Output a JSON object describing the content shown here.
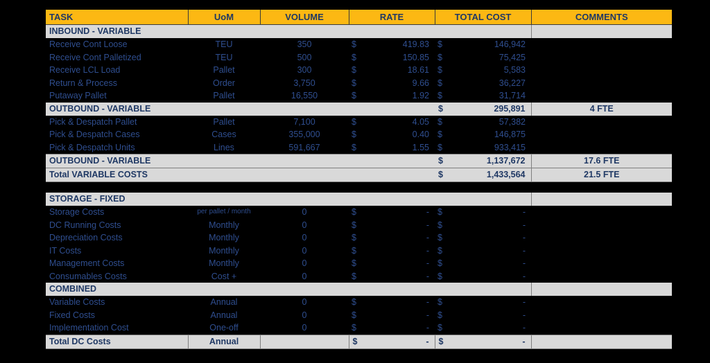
{
  "colors": {
    "header_bg": "#FCB813",
    "band_bg": "#D9D9D9",
    "text_navy": "#1F3864",
    "data_text": "#2F4E8F",
    "page_bg": "#000000"
  },
  "columns": [
    {
      "key": "task",
      "label": "TASK",
      "align": "left"
    },
    {
      "key": "uom",
      "label": "UoM",
      "align": "center"
    },
    {
      "key": "volume",
      "label": "VOLUME",
      "align": "center"
    },
    {
      "key": "rate",
      "label": "RATE",
      "align": "center"
    },
    {
      "key": "total_cost",
      "label": "TOTAL COST",
      "align": "center"
    },
    {
      "key": "comments",
      "label": "COMMENTS",
      "align": "center"
    }
  ],
  "sections": [
    {
      "band": {
        "label": "INBOUND - VARIABLE",
        "total_symbol": "",
        "total_value": "",
        "comments": ""
      },
      "rows": [
        {
          "task": "Receive Cont Loose",
          "uom": "TEU",
          "volume": "350",
          "rate_symbol": "$",
          "rate": "419.83",
          "tc_symbol": "$",
          "total_cost": "146,942",
          "comments": ""
        },
        {
          "task": "Receive Cont Palletized",
          "uom": "TEU",
          "volume": "500",
          "rate_symbol": "$",
          "rate": "150.85",
          "tc_symbol": "$",
          "total_cost": "75,425",
          "comments": ""
        },
        {
          "task": "Receive LCL Load",
          "uom": "Pallet",
          "volume": "300",
          "rate_symbol": "$",
          "rate": "18.61",
          "tc_symbol": "$",
          "total_cost": "5,583",
          "comments": ""
        },
        {
          "task": "Return & Process",
          "uom": "Order",
          "volume": "3,750",
          "rate_symbol": "$",
          "rate": "9.66",
          "tc_symbol": "$",
          "total_cost": "36,227",
          "comments": ""
        },
        {
          "task": "Putaway Pallet",
          "uom": "Pallet",
          "volume": "16,550",
          "rate_symbol": "$",
          "rate": "1.92",
          "tc_symbol": "$",
          "total_cost": "31,714",
          "comments": ""
        }
      ]
    },
    {
      "band": {
        "label": "OUTBOUND - VARIABLE",
        "total_symbol": "$",
        "total_value": "295,891",
        "comments": "4 FTE"
      },
      "rows": [
        {
          "task": "Pick & Despatch Pallet",
          "uom": "Pallet",
          "volume": "7,100",
          "rate_symbol": "$",
          "rate": "4.05",
          "tc_symbol": "$",
          "total_cost": "57,382",
          "comments": ""
        },
        {
          "task": "Pick & Despatch Cases",
          "uom": "Cases",
          "volume": "355,000",
          "rate_symbol": "$",
          "rate": "0.40",
          "tc_symbol": "$",
          "total_cost": "146,875",
          "comments": ""
        },
        {
          "task": "Pick & Despatch Units",
          "uom": "Lines",
          "volume": "591,667",
          "rate_symbol": "$",
          "rate": "1.55",
          "tc_symbol": "$",
          "total_cost": "933,415",
          "comments": ""
        }
      ]
    }
  ],
  "summary_bands": [
    {
      "label": "OUTBOUND - VARIABLE",
      "total_symbol": "$",
      "total_value": "1,137,672",
      "comments": "17.6 FTE"
    },
    {
      "label": "Total VARIABLE COSTS",
      "total_symbol": "$",
      "total_value": "1,433,564",
      "comments": "21.5 FTE"
    }
  ],
  "fixed_section": {
    "band": {
      "label": "STORAGE - FIXED"
    },
    "rows": [
      {
        "task": "Storage Costs",
        "uom": "per pallet / month",
        "uom_small": true,
        "volume": "0",
        "rate_symbol": "$",
        "rate": "-",
        "tc_symbol": "$",
        "total_cost": "-",
        "comments": ""
      },
      {
        "task": "DC Running Costs",
        "uom": "Monthly",
        "uom_small": false,
        "volume": "0",
        "rate_symbol": "$",
        "rate": "-",
        "tc_symbol": "$",
        "total_cost": "-",
        "comments": ""
      },
      {
        "task": "Depreciation Costs",
        "uom": "Monthly",
        "uom_small": false,
        "volume": "0",
        "rate_symbol": "$",
        "rate": "-",
        "tc_symbol": "$",
        "total_cost": "-",
        "comments": ""
      },
      {
        "task": "IT Costs",
        "uom": "Monthly",
        "uom_small": false,
        "volume": "0",
        "rate_symbol": "$",
        "rate": "-",
        "tc_symbol": "$",
        "total_cost": "-",
        "comments": ""
      },
      {
        "task": "Management Costs",
        "uom": "Monthly",
        "uom_small": false,
        "volume": "0",
        "rate_symbol": "$",
        "rate": "-",
        "tc_symbol": "$",
        "total_cost": "-",
        "comments": ""
      },
      {
        "task": "Consumables Costs",
        "uom": "Cost +",
        "uom_small": false,
        "volume": "0",
        "rate_symbol": "$",
        "rate": "-",
        "tc_symbol": "$",
        "total_cost": "-",
        "comments": ""
      }
    ]
  },
  "combined_section": {
    "band": {
      "label": "COMBINED"
    },
    "rows": [
      {
        "task": "Variable Costs",
        "uom": "Annual",
        "volume": "0",
        "rate_symbol": "$",
        "rate": "-",
        "tc_symbol": "$",
        "total_cost": "-",
        "comments": ""
      },
      {
        "task": "Fixed Costs",
        "uom": "Annual",
        "volume": "0",
        "rate_symbol": "$",
        "rate": "-",
        "tc_symbol": "$",
        "total_cost": "-",
        "comments": ""
      },
      {
        "task": "Implementation Cost",
        "uom": "One-off",
        "volume": "0",
        "rate_symbol": "$",
        "rate": "-",
        "tc_symbol": "$",
        "total_cost": "-",
        "comments": ""
      }
    ],
    "total_row": {
      "task": "Total DC Costs",
      "uom": "Annual",
      "volume": "",
      "rate_symbol": "$",
      "rate": "-",
      "tc_symbol": "$",
      "total_cost": "-",
      "comments": ""
    }
  }
}
